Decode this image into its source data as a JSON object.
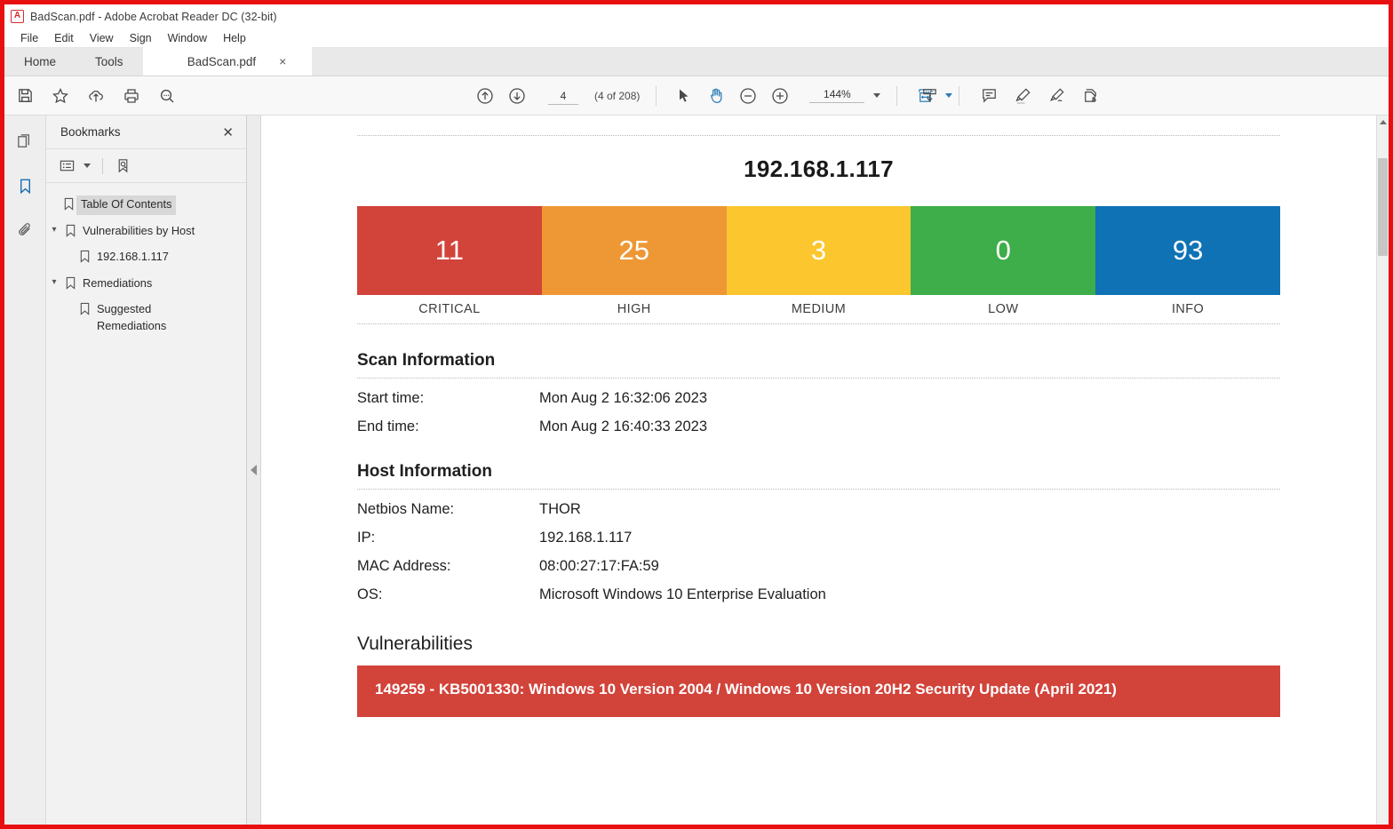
{
  "window": {
    "title": "BadScan.pdf - Adobe Acrobat Reader DC (32-bit)",
    "app_icon": "pdf-document-icon"
  },
  "menubar": {
    "items": [
      "File",
      "Edit",
      "View",
      "Sign",
      "Window",
      "Help"
    ]
  },
  "tabs": {
    "home_label": "Home",
    "tools_label": "Tools",
    "document_label": "BadScan.pdf",
    "close_label": "×"
  },
  "toolbar": {
    "left_icons": [
      "save-icon",
      "star-icon",
      "upload-cloud-icon",
      "print-icon",
      "zoom-search-icon"
    ],
    "page_value": "4",
    "page_count_label": "(4 of 208)",
    "zoom_value": "144%",
    "center_icons": [
      "previous-page-icon",
      "next-page-icon",
      "select-cursor-icon",
      "hand-tool-icon",
      "zoom-out-icon",
      "zoom-in-icon",
      "fit-page-width-icon"
    ],
    "right_icons": [
      "scroll-to-page-icon",
      "comment-icon",
      "highlight-icon",
      "sign-icon",
      "fill-and-sign-icon"
    ]
  },
  "rail": {
    "icons": [
      "page-thumbnails-icon",
      "bookmarks-icon",
      "attachments-icon"
    ]
  },
  "panel": {
    "title": "Bookmarks",
    "close_label": "✕",
    "tools": [
      "bookmark-options-icon",
      "new-bookmark-icon"
    ],
    "bookmarks": [
      {
        "label": "Table Of Contents",
        "level": 0,
        "expandable": false,
        "selected": true
      },
      {
        "label": "Vulnerabilities by Host",
        "level": 0,
        "expandable": true,
        "selected": false
      },
      {
        "label": "192.168.1.117",
        "level": 1,
        "expandable": false,
        "selected": false
      },
      {
        "label": "Remediations",
        "level": 0,
        "expandable": true,
        "selected": false
      },
      {
        "label": "Suggested Remediations",
        "level": 1,
        "expandable": false,
        "selected": false
      }
    ]
  },
  "document": {
    "host_title": "192.168.1.117",
    "scan_information": {
      "heading": "Scan Information",
      "rows": [
        {
          "key": "Start time:",
          "value": "Mon Aug 2 16:32:06 2023"
        },
        {
          "key": "End time:",
          "value": "Mon Aug 2 16:40:33 2023"
        }
      ]
    },
    "host_information": {
      "heading": "Host Information",
      "rows": [
        {
          "key": "Netbios Name:",
          "value": "THOR"
        },
        {
          "key": "IP:",
          "value": "192.168.1.117"
        },
        {
          "key": "MAC Address:",
          "value": "08:00:27:17:FA:59"
        },
        {
          "key": "OS:",
          "value": "Microsoft Windows 10 Enterprise Evaluation"
        }
      ]
    },
    "vulnerabilities": {
      "heading": "Vulnerabilities",
      "items": [
        {
          "label": "149259 - KB5001330: Windows 10 Version 2004 / Windows 10 Version 20H2 Security Update (April 2021)",
          "severity": "critical",
          "color": "#d2433a"
        }
      ]
    }
  },
  "chart_data": {
    "type": "bar",
    "title": "192.168.1.117",
    "categories": [
      "CRITICAL",
      "HIGH",
      "MEDIUM",
      "LOW",
      "INFO"
    ],
    "values": [
      11,
      25,
      3,
      0,
      93
    ],
    "colors": [
      "#d2433a",
      "#ed9835",
      "#fcc62f",
      "#3dae49",
      "#0e72b5"
    ],
    "xlabel": "",
    "ylabel": "",
    "legend": "none",
    "grid": false,
    "note": "Equal-width severity summary blocks; the count is printed inside each block and the severity name below it."
  },
  "theme": {
    "accent_blue": "#1a6fb5",
    "window_border": "#e8100f",
    "critical": "#d2433a",
    "high": "#ed9835",
    "medium": "#fcc62f",
    "low": "#3dae49",
    "info": "#0e72b5"
  }
}
